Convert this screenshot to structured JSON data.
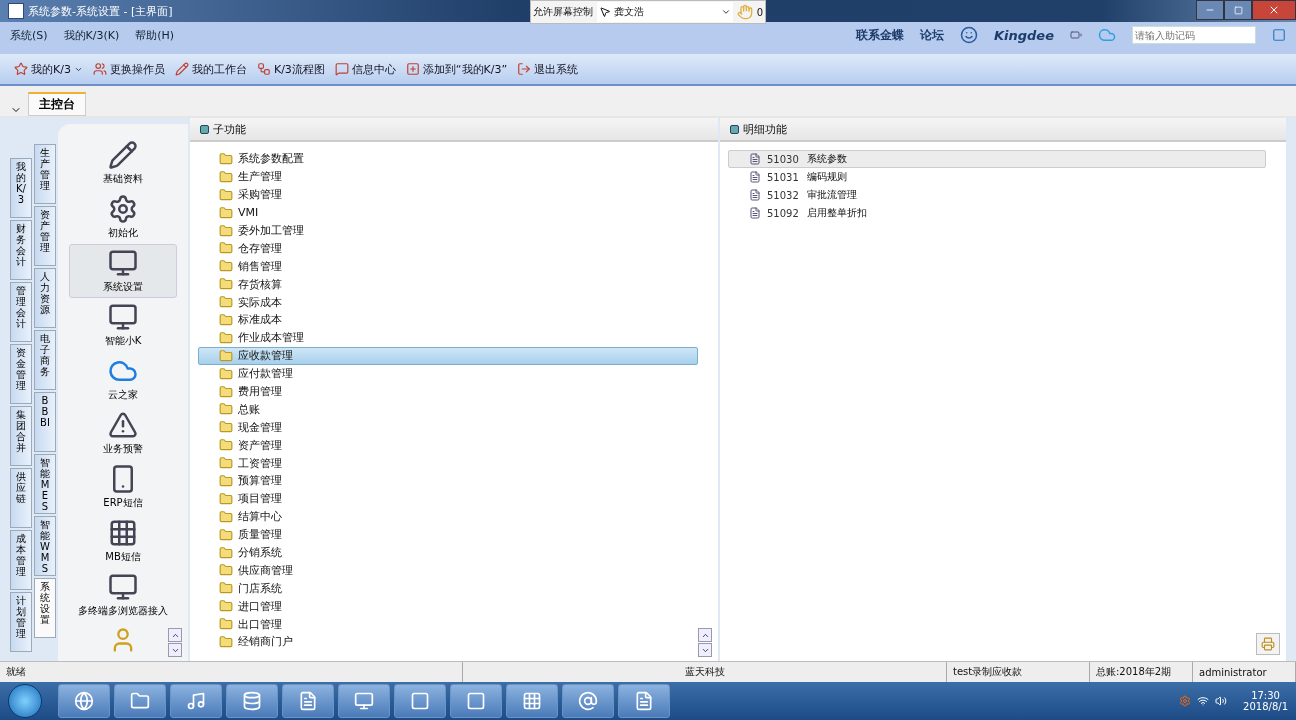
{
  "window": {
    "title": "系统参数-系统设置 - [主界面]"
  },
  "screen_control": {
    "label": "允许屏幕控制",
    "user": "龚文浩",
    "count": "0"
  },
  "menu": [
    "系统(S)",
    "我的K/3(K)",
    "帮助(H)"
  ],
  "top_links": [
    "联系金蝶",
    "论坛"
  ],
  "brand": "Kingdee",
  "mnemonic_field": {
    "placeholder": "请输入助记码"
  },
  "toolbar": [
    {
      "label": "我的K/3",
      "dropdown": true
    },
    {
      "label": "更换操作员",
      "dropdown": false
    },
    {
      "label": "我的工作台",
      "dropdown": false
    },
    {
      "label": "K/3流程图",
      "dropdown": false
    },
    {
      "label": "信息中心",
      "dropdown": false
    },
    {
      "label": "添加到“我的K/3”",
      "dropdown": false
    },
    {
      "label": "退出系统",
      "dropdown": false
    }
  ],
  "tabs": [
    {
      "label": "主控台",
      "selected": true
    }
  ],
  "module_tabs_outer": [
    {
      "label": "我的K/3",
      "selected": false
    },
    {
      "label": "财务会计",
      "selected": false
    },
    {
      "label": "管理会计",
      "selected": false
    },
    {
      "label": "资金管理",
      "selected": false
    },
    {
      "label": "集团合并",
      "selected": false
    },
    {
      "label": "供应链",
      "selected": false
    },
    {
      "label": "成本管理",
      "selected": false
    },
    {
      "label": "计划管理",
      "selected": false
    }
  ],
  "module_tabs_inner": [
    {
      "label": "生产管理",
      "selected": false
    },
    {
      "label": "资产管理",
      "selected": false
    },
    {
      "label": "人力资源",
      "selected": false
    },
    {
      "label": "电子商务",
      "selected": false
    },
    {
      "label": "BBBI",
      "selected": false
    },
    {
      "label": "智能MES",
      "selected": false
    },
    {
      "label": "智能WMS",
      "selected": false
    },
    {
      "label": "系统设置",
      "selected": true
    }
  ],
  "function_icons": [
    {
      "label": "基础资料",
      "selected": false
    },
    {
      "label": "初始化",
      "selected": false
    },
    {
      "label": "系统设置",
      "selected": true
    },
    {
      "label": "智能小K",
      "selected": false
    },
    {
      "label": "云之家",
      "selected": false
    },
    {
      "label": "业务预警",
      "selected": false
    },
    {
      "label": "ERP短信",
      "selected": false
    },
    {
      "label": "MB短信",
      "selected": false
    },
    {
      "label": "多终端多浏览器接入",
      "selected": false
    }
  ],
  "subfunctions": {
    "title": "子功能",
    "items": [
      {
        "label": "系统参数配置",
        "selected": false
      },
      {
        "label": "生产管理",
        "selected": false
      },
      {
        "label": "采购管理",
        "selected": false
      },
      {
        "label": "VMI",
        "selected": false
      },
      {
        "label": "委外加工管理",
        "selected": false
      },
      {
        "label": "仓存管理",
        "selected": false
      },
      {
        "label": "销售管理",
        "selected": false
      },
      {
        "label": "存货核算",
        "selected": false
      },
      {
        "label": "实际成本",
        "selected": false
      },
      {
        "label": "标准成本",
        "selected": false
      },
      {
        "label": "作业成本管理",
        "selected": false
      },
      {
        "label": "应收款管理",
        "selected": true
      },
      {
        "label": "应付款管理",
        "selected": false
      },
      {
        "label": "费用管理",
        "selected": false
      },
      {
        "label": "总账",
        "selected": false
      },
      {
        "label": "现金管理",
        "selected": false
      },
      {
        "label": "资产管理",
        "selected": false
      },
      {
        "label": "工资管理",
        "selected": false
      },
      {
        "label": "预算管理",
        "selected": false
      },
      {
        "label": "项目管理",
        "selected": false
      },
      {
        "label": "结算中心",
        "selected": false
      },
      {
        "label": "质量管理",
        "selected": false
      },
      {
        "label": "分销系统",
        "selected": false
      },
      {
        "label": "供应商管理",
        "selected": false
      },
      {
        "label": "门店系统",
        "selected": false
      },
      {
        "label": "进口管理",
        "selected": false
      },
      {
        "label": "出口管理",
        "selected": false
      },
      {
        "label": "经销商门户",
        "selected": false
      }
    ]
  },
  "details": {
    "title": "明细功能",
    "items": [
      {
        "code": "51030",
        "label": "系统参数",
        "selected": true
      },
      {
        "code": "51031",
        "label": "编码规则",
        "selected": false
      },
      {
        "code": "51032",
        "label": "审批流管理",
        "selected": false
      },
      {
        "code": "51092",
        "label": "启用整单折扣",
        "selected": false
      }
    ]
  },
  "status_bar": [
    "就绪",
    "蓝天科技",
    "test录制应收款",
    "总账:2018年2期",
    "administrator"
  ],
  "taskbar": {
    "time": "17:30",
    "date": "2018/8/1"
  }
}
